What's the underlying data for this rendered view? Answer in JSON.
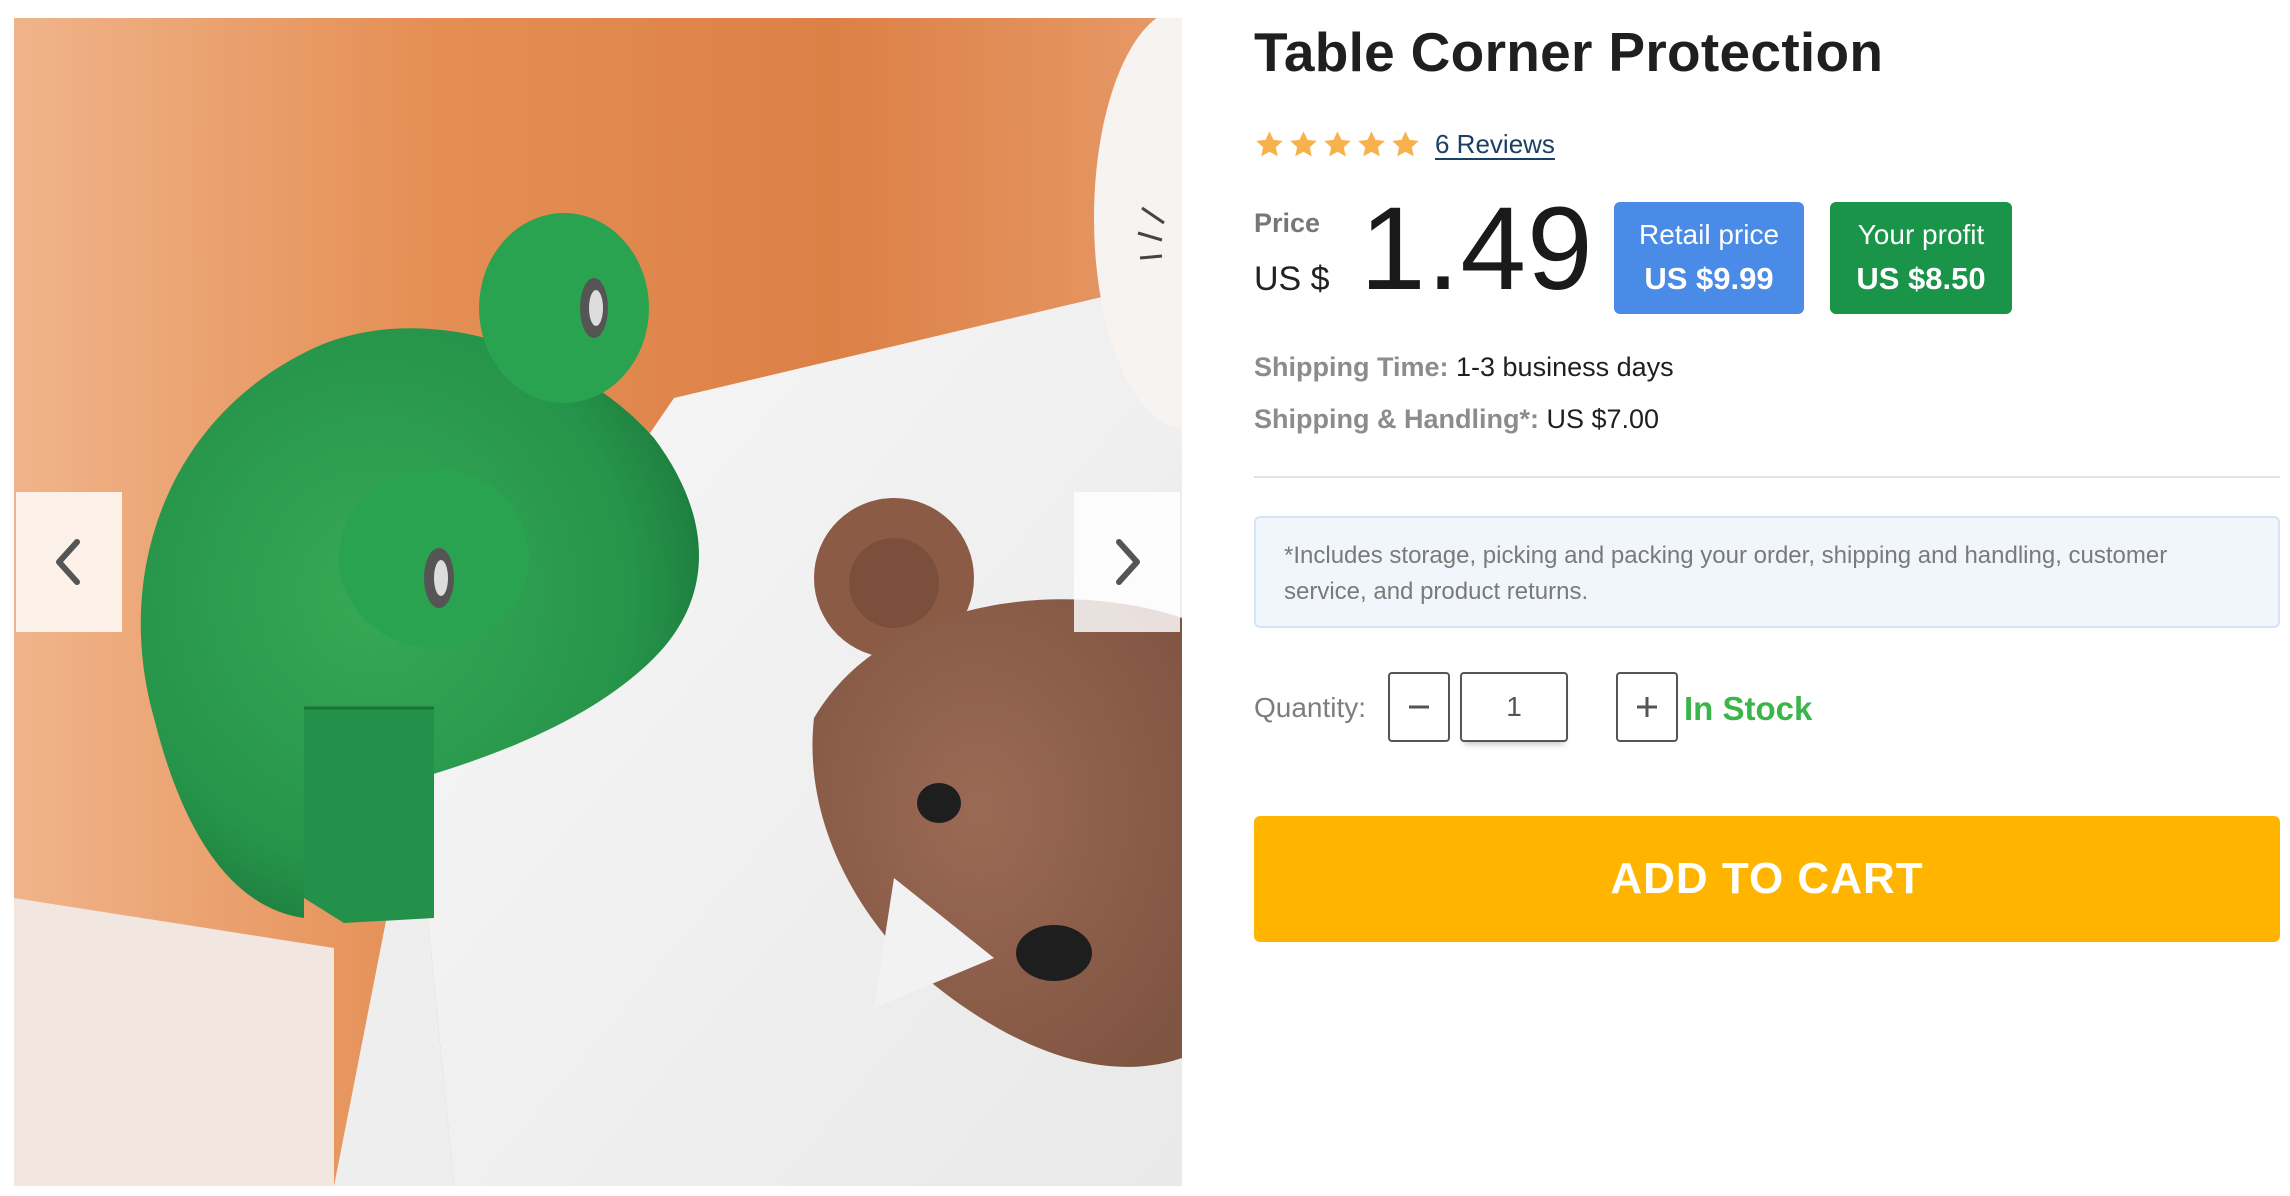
{
  "product": {
    "title": "Table Corner Protection",
    "rating": {
      "stars": 5,
      "max_stars": 5,
      "star_color": "#f7b14d",
      "reviews_label": "6 Reviews"
    },
    "price": {
      "label": "Price",
      "currency": "US $",
      "value": "1.49"
    },
    "retail": {
      "label": "Retail price",
      "value": "US $9.99",
      "color": "#4a8be8"
    },
    "profit": {
      "label": "Your profit",
      "value": "US $8.50",
      "color": "#1a9448"
    },
    "shipping": {
      "time_label": "Shipping Time:",
      "time_value": "1-3 business days",
      "handling_label": "Shipping & Handling*:",
      "handling_value": "US $7.00"
    },
    "note": "*Includes storage, picking and packing your order, shipping and handling, customer service, and product returns.",
    "quantity": {
      "label": "Quantity:",
      "value": "1",
      "decrement_icon": "minus-icon",
      "increment_icon": "plus-icon"
    },
    "stock_status": "In Stock",
    "stock_color": "#3ab54a",
    "add_to_cart_label": "ADD TO CART",
    "add_to_cart_color": "#ffb400"
  },
  "gallery": {
    "prev_icon": "chevron-left-icon",
    "next_icon": "chevron-right-icon"
  }
}
